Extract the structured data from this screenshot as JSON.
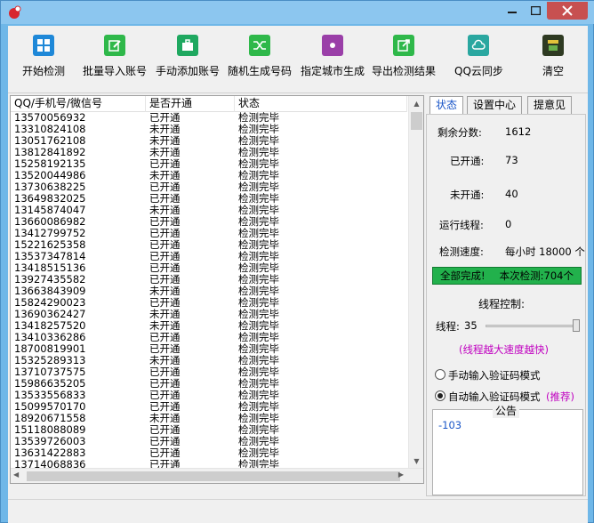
{
  "toolbar": {
    "items": [
      {
        "label": "开始检测",
        "icon": "windows-icon",
        "color": "#1e88d8"
      },
      {
        "label": "批量导入账号",
        "icon": "edit-icon",
        "color": "#2fb84a"
      },
      {
        "label": "手动添加账号",
        "icon": "briefcase-icon",
        "color": "#1fa860"
      },
      {
        "label": "随机生成号码",
        "icon": "shuffle-icon",
        "color": "#2fb84a"
      },
      {
        "label": "指定城市生成",
        "icon": "target-icon",
        "color": "#9a3fa8"
      },
      {
        "label": "导出检测结果",
        "icon": "export-icon",
        "color": "#2fb84a"
      },
      {
        "label": "QQ云同步",
        "icon": "cloud-icon",
        "color": "#2aa7a0"
      },
      {
        "label": "清空",
        "icon": "trash-icon",
        "color": "#6a7a2a"
      }
    ]
  },
  "table": {
    "headers": [
      "QQ/手机号/微信号",
      "是否开通",
      "状态"
    ],
    "rows": [
      [
        "13570056932",
        "已开通",
        "检测完毕"
      ],
      [
        "13310824108",
        "未开通",
        "检测完毕"
      ],
      [
        "13051762108",
        "未开通",
        "检测完毕"
      ],
      [
        "13812841892",
        "未开通",
        "检测完毕"
      ],
      [
        "15258192135",
        "已开通",
        "检测完毕"
      ],
      [
        "13520044986",
        "未开通",
        "检测完毕"
      ],
      [
        "13730638225",
        "已开通",
        "检测完毕"
      ],
      [
        "13649832025",
        "已开通",
        "检测完毕"
      ],
      [
        "13145874047",
        "未开通",
        "检测完毕"
      ],
      [
        "13660086982",
        "已开通",
        "检测完毕"
      ],
      [
        "13412799752",
        "已开通",
        "检测完毕"
      ],
      [
        "15221625358",
        "已开通",
        "检测完毕"
      ],
      [
        "13537347814",
        "已开通",
        "检测完毕"
      ],
      [
        "13418515136",
        "已开通",
        "检测完毕"
      ],
      [
        "13927435582",
        "已开通",
        "检测完毕"
      ],
      [
        "13663843909",
        "未开通",
        "检测完毕"
      ],
      [
        "15824290023",
        "已开通",
        "检测完毕"
      ],
      [
        "13690362427",
        "未开通",
        "检测完毕"
      ],
      [
        "13418257520",
        "未开通",
        "检测完毕"
      ],
      [
        "13410336286",
        "已开通",
        "检测完毕"
      ],
      [
        "18700819901",
        "已开通",
        "检测完毕"
      ],
      [
        "15325289313",
        "未开通",
        "检测完毕"
      ],
      [
        "13710737575",
        "已开通",
        "检测完毕"
      ],
      [
        "15986635205",
        "已开通",
        "检测完毕"
      ],
      [
        "13533556833",
        "已开通",
        "检测完毕"
      ],
      [
        "15099570170",
        "已开通",
        "检测完毕"
      ],
      [
        "18920671558",
        "未开通",
        "检测完毕"
      ],
      [
        "15118088089",
        "已开通",
        "检测完毕"
      ],
      [
        "13539726003",
        "已开通",
        "检测完毕"
      ],
      [
        "13631422883",
        "已开通",
        "检测完毕"
      ],
      [
        "13714068836",
        "已开通",
        "检测完毕"
      ]
    ]
  },
  "tabs": [
    "状态",
    "设置中心",
    "提意见"
  ],
  "status": {
    "remaining_label": "剩余分数:",
    "remaining_value": "1612",
    "opened_label": "已开通:",
    "opened_value": "73",
    "not_opened_label": "未开通:",
    "not_opened_value": "40",
    "threads_label": "运行线程:",
    "threads_value": "0",
    "speed_label": "检测速度:",
    "speed_value": "每小时 18000 个",
    "complete_left": "全部完成!",
    "complete_right": "本次检测:704个",
    "thread_control": "线程控制:",
    "thread_label": "线程:",
    "thread_value": "35",
    "thread_tip": "(线程越大速度越快)",
    "manual_mode": "手动输入验证码模式",
    "auto_mode": "自动输入验证码模式",
    "recommend": "(推荐)",
    "notice_title": "公告",
    "notice_text": "-103"
  },
  "colors": {
    "accent_blue": "#1a56c8",
    "progress_green": "#22b14c",
    "tip_magenta": "#c000c0",
    "close_red": "#c75050"
  }
}
